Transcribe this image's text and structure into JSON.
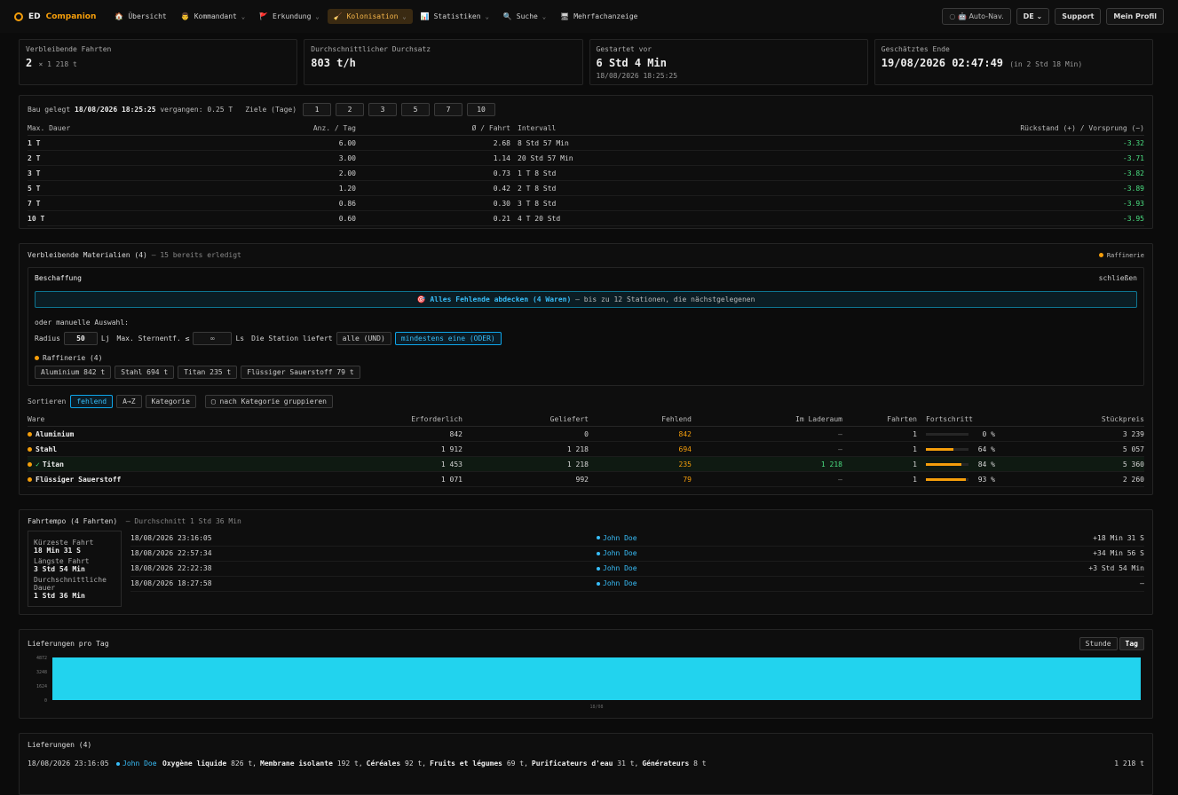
{
  "nav": {
    "brand_a": "ED",
    "brand_b": "Companion",
    "items": [
      {
        "label": "Übersicht",
        "icon": "house-icon",
        "glyph": "🏠",
        "chev": ""
      },
      {
        "label": "Kommandant",
        "icon": "person-icon",
        "glyph": "👨",
        "chev": "⌄"
      },
      {
        "label": "Erkundung",
        "icon": "flag-icon",
        "glyph": "🚩",
        "chev": "⌄"
      },
      {
        "label": "Kolonisation",
        "icon": "broom-icon",
        "glyph": "🧹",
        "chev": "⌄"
      },
      {
        "label": "Statistiken",
        "icon": "chart-icon",
        "glyph": "📊",
        "chev": "⌄"
      },
      {
        "label": "Suche",
        "icon": "search-icon",
        "glyph": "🔍",
        "chev": "⌄"
      },
      {
        "label": "Mehrfachanzeige",
        "icon": "monitor-icon",
        "glyph": "🖥",
        "chev": ""
      }
    ],
    "autonav": "Auto-Nav.",
    "lang": "DE",
    "support": "Support",
    "profile": "Mein Profil"
  },
  "cards": [
    {
      "label": "Verbleibende Fahrten",
      "value": "2",
      "suffix": "× 1 218 t",
      "sub": ""
    },
    {
      "label": "Durchschnittlicher Durchsatz",
      "value": "803 t/h",
      "suffix": "",
      "sub": ""
    },
    {
      "label": "Gestartet vor",
      "value": "6 Std 4 Min",
      "suffix": "",
      "sub": "18/08/2026 18:25:25"
    },
    {
      "label": "Geschätztes Ende",
      "value": "19/08/2026 02:47:49",
      "suffix": "(in 2 Std 18 Min)",
      "sub": ""
    }
  ],
  "targets": {
    "prefix": "Bau gelegt",
    "date": "18/08/2026 18:25:25",
    "elapsed": "vergangen: 0.25 T",
    "goals_label": "Ziele (Tage)",
    "buttons": [
      "1",
      "2",
      "3",
      "5",
      "7",
      "10"
    ],
    "headers": [
      "Max. Dauer",
      "Anz. / Tag",
      "Ø / Fahrt",
      "Intervall",
      "Rückstand (+) / Vorsprung (−)"
    ],
    "rows": [
      [
        "1 T",
        "6.00",
        "2.68",
        "8 Std 57 Min",
        "-3.32"
      ],
      [
        "2 T",
        "3.00",
        "1.14",
        "20 Std 57 Min",
        "-3.71"
      ],
      [
        "3 T",
        "2.00",
        "0.73",
        "1 T 8 Std",
        "-3.82"
      ],
      [
        "5 T",
        "1.20",
        "0.42",
        "2 T 8 Std",
        "-3.89"
      ],
      [
        "7 T",
        "0.86",
        "0.30",
        "3 T 8 Std",
        "-3.93"
      ],
      [
        "10 T",
        "0.60",
        "0.21",
        "4 T 20 Std",
        "-3.95"
      ]
    ]
  },
  "materials": {
    "title": "Verbleibende Materialien (4)",
    "done": "— 15 bereits erledigt",
    "legend": "Raffinerie",
    "proc_title": "Beschaffung",
    "close": "schließen",
    "cta_strong": "Alles Fehlende abdecken (4 Waren)",
    "cta_rest": "— bis zu 12 Stationen, die nächstgelegenen",
    "manual": "oder manuelle Auswahl:",
    "radius_label": "Radius",
    "radius_value": "50",
    "radius_unit": "Lj",
    "dist_label": "Max. Sternentf. ≤",
    "dist_value": "∞",
    "dist_unit": "Ls",
    "station_label": "Die Station liefert",
    "opt_all": "alle (UND)",
    "opt_any": "mindestens eine (ODER)",
    "group_label": "Raffinerie (4)",
    "chips": [
      "Aluminium 842 t",
      "Stahl 694 t",
      "Titan 235 t",
      "Flüssiger Sauerstoff 79 t"
    ],
    "sort_label": "Sortieren",
    "sorts": [
      "fehlend",
      "A→Z",
      "Kategorie"
    ],
    "group_toggle": "nach Kategorie gruppieren",
    "headers": [
      "Ware",
      "Erforderlich",
      "Geliefert",
      "Fehlend",
      "Im Laderaum",
      "Fahrten",
      "Fortschritt",
      "Stückpreis"
    ],
    "rows": [
      {
        "name": "Aluminium",
        "check": "",
        "req": "842",
        "del": "0",
        "miss": "842",
        "cargo": "—",
        "trips": "1",
        "pct": "0 %",
        "progress": 0,
        "price": "3 239"
      },
      {
        "name": "Stahl",
        "check": "",
        "req": "1 912",
        "del": "1 218",
        "miss": "694",
        "cargo": "—",
        "trips": "1",
        "pct": "64 %",
        "progress": 0.64,
        "price": "5 057"
      },
      {
        "name": "Titan",
        "check": "✓",
        "req": "1 453",
        "del": "1 218",
        "miss": "235",
        "cargo": "1 218",
        "trips": "1",
        "pct": "84 %",
        "progress": 0.84,
        "price": "5 360"
      },
      {
        "name": "Flüssiger Sauerstoff",
        "check": "",
        "req": "1 071",
        "del": "992",
        "miss": "79",
        "cargo": "—",
        "trips": "1",
        "pct": "93 %",
        "progress": 0.93,
        "price": "2 260"
      }
    ]
  },
  "tempo": {
    "title": "Fahrtempo (4 Fahrten)",
    "avg": "— Durchschnitt 1 Std 36 Min",
    "shortest_l": "Kürzeste Fahrt",
    "shortest_v": "18 Min 31 S",
    "longest_l": "Längste Fahrt",
    "longest_v": "3 Std 54 Min",
    "avg_l": "Durchschnittliche Dauer",
    "avg_v": "1 Std 36 Min",
    "rows": [
      [
        "18/08/2026 23:16:05",
        "John Doe",
        "+18 Min 31 S"
      ],
      [
        "18/08/2026 22:57:34",
        "John Doe",
        "+34 Min 56 S"
      ],
      [
        "18/08/2026 22:22:38",
        "John Doe",
        "+3 Std 54 Min"
      ],
      [
        "18/08/2026 18:27:58",
        "John Doe",
        "—"
      ]
    ]
  },
  "deliveries_chart": {
    "title": "Lieferungen pro Tag",
    "btn_hour": "Stunde",
    "btn_day": "Tag",
    "color": "#22d3ee"
  },
  "chart_data": {
    "type": "bar",
    "categories": [
      "18/08"
    ],
    "values": [
      4872
    ],
    "yticks": [
      "4872",
      "3248",
      "1624",
      "0"
    ],
    "ylim": [
      0,
      4872
    ],
    "title": "Lieferungen pro Tag"
  },
  "deliveries": {
    "title": "Lieferungen (4)",
    "row": {
      "time": "18/08/2026 23:16:05",
      "who": "John Doe",
      "items": [
        [
          "Oxygène liquide",
          "826 t"
        ],
        [
          "Membrane isolante",
          "192 t"
        ],
        [
          "Céréales",
          "92 t"
        ],
        [
          "Fruits et légumes",
          "69 t"
        ],
        [
          "Purificateurs d'eau",
          "31 t"
        ],
        [
          "Générateurs",
          "8 t"
        ]
      ],
      "total": "1 218 t"
    }
  }
}
